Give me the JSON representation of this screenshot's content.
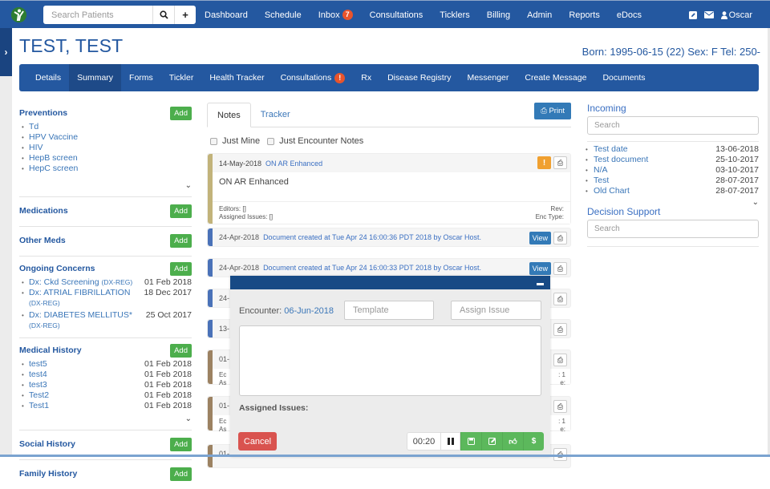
{
  "topbar": {
    "search_placeholder": "Search Patients",
    "search_icon": "search-icon",
    "add_icon": "plus-icon",
    "nav": [
      {
        "label": "Dashboard"
      },
      {
        "label": "Schedule"
      },
      {
        "label": "Inbox",
        "badge": "7"
      },
      {
        "label": "Consultations"
      },
      {
        "label": "Ticklers"
      },
      {
        "label": "Billing"
      },
      {
        "label": "Admin"
      },
      {
        "label": "Reports"
      },
      {
        "label": "eDocs"
      }
    ],
    "user": "Oscar",
    "icons": [
      "edit-icon",
      "mail-icon",
      "user-icon"
    ]
  },
  "patient": {
    "name": "TEST, TEST",
    "demographics": "Born: 1995-06-15 (22) Sex: F Tel: 250-"
  },
  "subnav": [
    {
      "label": "Details"
    },
    {
      "label": "Summary",
      "active": true
    },
    {
      "label": "Forms"
    },
    {
      "label": "Tickler"
    },
    {
      "label": "Health Tracker"
    },
    {
      "label": "Consultations",
      "badge": "!"
    },
    {
      "label": "Rx"
    },
    {
      "label": "Disease Registry"
    },
    {
      "label": "Messenger"
    },
    {
      "label": "Create Message"
    },
    {
      "label": "Documents"
    }
  ],
  "left": {
    "add_label": "Add",
    "preventions": {
      "title": "Preventions",
      "items": [
        "Td",
        "HPV Vaccine",
        "HIV",
        "HepB screen",
        "HepC screen"
      ]
    },
    "medications": {
      "title": "Medications"
    },
    "other_meds": {
      "title": "Other Meds"
    },
    "ongoing": {
      "title": "Ongoing Concerns",
      "items": [
        {
          "name": "Dx: Ckd Screening",
          "tag": "(DX-REG)",
          "date": "01 Feb 2018"
        },
        {
          "name": "Dx: ATRIAL FIBRILLATION",
          "tag": "(DX-REG)",
          "date": "18 Dec 2017"
        },
        {
          "name": "Dx: DIABETES MELLITUS*",
          "tag": "(DX-REG)",
          "date": "25 Oct 2017"
        }
      ]
    },
    "medical_history": {
      "title": "Medical History",
      "items": [
        {
          "name": "test5",
          "date": "01 Feb 2018"
        },
        {
          "name": "test4",
          "date": "01 Feb 2018"
        },
        {
          "name": "test3",
          "date": "01 Feb 2018"
        },
        {
          "name": "Test2",
          "date": "01 Feb 2018"
        },
        {
          "name": "Test1",
          "date": "01 Feb 2018"
        }
      ]
    },
    "social_history": {
      "title": "Social History"
    },
    "family_history": {
      "title": "Family History"
    }
  },
  "center": {
    "tabs": [
      {
        "label": "Notes",
        "active": true
      },
      {
        "label": "Tracker"
      }
    ],
    "print_label": "Print",
    "filters": [
      "Just Mine",
      "Just Encounter Notes"
    ],
    "view_label": "View",
    "notes": [
      {
        "date": "14-May-2018",
        "title": "ON AR Enhanced",
        "body": "ON AR Enhanced",
        "editors": "Editors: []",
        "issues": "Assigned Issues: []",
        "rev": "Rev:",
        "enc_type": "Enc Type:",
        "color": "#c2b37a"
      },
      {
        "date": "24-Apr-2018",
        "title": "Document created at Tue Apr 24 16:00:36 PDT 2018 by Oscar Host.",
        "color": "#4a72b8"
      },
      {
        "date": "24-Apr-2018",
        "title": "Document created at Tue Apr 24 16:00:33 PDT 2018 by Oscar Host.",
        "color": "#4a72b8"
      },
      {
        "date": "24-",
        "color": "#4a72b8"
      },
      {
        "date": "13-",
        "color": "#4a72b8"
      },
      {
        "date": "01-",
        "foot1": "Ec",
        "foot2": "As",
        "rev": ": 1",
        "enc_type": "e:",
        "color": "#9c8262"
      },
      {
        "date": "01-",
        "foot1": "Ec",
        "foot2": "As",
        "rev": ": 1",
        "enc_type": "e:",
        "color": "#9c8262"
      },
      {
        "date": "01-",
        "color": "#9c8262"
      }
    ]
  },
  "encounter": {
    "label": "Encounter:",
    "date": "06-Jun-2018",
    "template_placeholder": "Template",
    "issue_placeholder": "Assign Issue",
    "assigned_issues": "Assigned Issues:",
    "cancel": "Cancel",
    "timer": "00:20"
  },
  "right": {
    "incoming": {
      "title": "Incoming",
      "search_placeholder": "Search",
      "items": [
        {
          "name": "Test date",
          "date": "13-06-2018"
        },
        {
          "name": "Test document",
          "date": "25-10-2017"
        },
        {
          "name": "N/A",
          "date": "03-10-2017"
        },
        {
          "name": "Test",
          "date": "28-07-2017"
        },
        {
          "name": "Old Chart",
          "date": "28-07-2017"
        }
      ]
    },
    "decision_support": {
      "title": "Decision Support",
      "search_placeholder": "Search"
    }
  },
  "colors": {
    "brand": "#2458a0",
    "add": "#4cae4c",
    "danger": "#d9534f",
    "primary": "#337ab7",
    "warning": "#f0a030",
    "badge": "#e8542c"
  }
}
